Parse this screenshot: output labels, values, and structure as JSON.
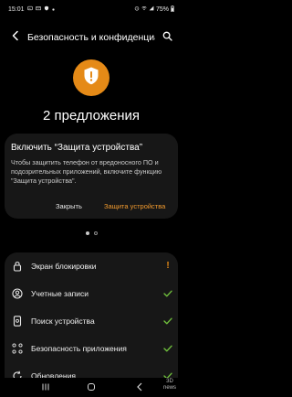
{
  "status_bar": {
    "time": "15:01",
    "battery": "75%",
    "icons": [
      "image-icon",
      "mail-icon",
      "shield-status-icon",
      "dot-icon",
      "alarm-icon",
      "wifi-icon",
      "signal-icon",
      "battery-icon"
    ]
  },
  "app_bar": {
    "title": "Безопасность и конфиденциальность",
    "back_icon": "back-arrow-icon",
    "search_icon": "search-icon"
  },
  "header": {
    "shield_icon": "shield-alert-icon",
    "accent_color": "#e58a17",
    "suggestions": "2 предложения"
  },
  "card": {
    "title": "Включить “Защита устройства”",
    "body": "Чтобы защитить телефон от вредоносного ПО и подозрительных приложений, включите функцию \"Защита устройства\".",
    "close_label": "Закрыть",
    "action_label": "Защита устройства",
    "action_color": "#f19a2e"
  },
  "pager": {
    "page": 1,
    "pages": 2
  },
  "list": {
    "items": [
      {
        "label": "Экран блокировки",
        "icon": "lock-icon",
        "status": "warning",
        "status_symbol": "!"
      },
      {
        "label": "Учетные записи",
        "icon": "account-icon",
        "status": "ok"
      },
      {
        "label": "Поиск устройства",
        "icon": "find-device-icon",
        "status": "ok"
      },
      {
        "label": "Безопасность приложения",
        "icon": "apps-grid-icon",
        "status": "ok"
      },
      {
        "label": "Обновления",
        "icon": "update-icon",
        "status": "ok"
      }
    ],
    "check_color": "#6fbf3c"
  },
  "nav_bar": {
    "buttons": [
      "recent-apps-icon",
      "home-icon",
      "back-nav-icon"
    ]
  },
  "watermark": {
    "text": "3D\nnews"
  }
}
